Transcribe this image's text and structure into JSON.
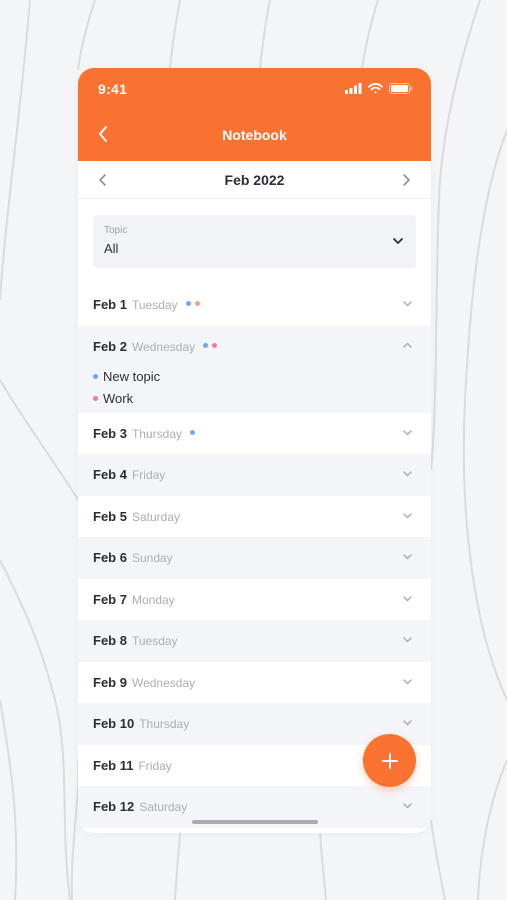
{
  "status": {
    "time": "9:41"
  },
  "nav": {
    "title": "Notebook"
  },
  "month": {
    "label": "Feb 2022"
  },
  "topic_filter": {
    "caption": "Topic",
    "value": "All"
  },
  "days": [
    {
      "date": "Feb 1",
      "weekday": "Tuesday",
      "dots": [
        "#6ea8f0",
        "#f4a27a"
      ],
      "expanded": false
    },
    {
      "date": "Feb 2",
      "weekday": "Wednesday",
      "dots": [
        "#6ea8f0",
        "#f07a9a"
      ],
      "expanded": true,
      "topics": [
        {
          "label": "New topic",
          "color": "#6ea8f0"
        },
        {
          "label": "Work",
          "color": "#f07a9a"
        }
      ]
    },
    {
      "date": "Feb 3",
      "weekday": "Thursday",
      "dots": [
        "#6ea8f0"
      ],
      "expanded": false
    },
    {
      "date": "Feb 4",
      "weekday": "Friday",
      "dots": [],
      "expanded": false
    },
    {
      "date": "Feb 5",
      "weekday": "Saturday",
      "dots": [],
      "expanded": false
    },
    {
      "date": "Feb 6",
      "weekday": "Sunday",
      "dots": [],
      "expanded": false
    },
    {
      "date": "Feb 7",
      "weekday": "Monday",
      "dots": [],
      "expanded": false
    },
    {
      "date": "Feb 8",
      "weekday": "Tuesday",
      "dots": [],
      "expanded": false
    },
    {
      "date": "Feb 9",
      "weekday": "Wednesday",
      "dots": [],
      "expanded": false
    },
    {
      "date": "Feb 10",
      "weekday": "Thursday",
      "dots": [],
      "expanded": false
    },
    {
      "date": "Feb 11",
      "weekday": "Friday",
      "dots": [],
      "expanded": false
    },
    {
      "date": "Feb 12",
      "weekday": "Saturday",
      "dots": [],
      "expanded": false
    }
  ],
  "colors": {
    "accent": "#f97231",
    "text": "#2a2e38",
    "muted": "#a9aeb8",
    "row_alt": "#f4f5f8"
  },
  "icons": {
    "back": "chevron-left-icon",
    "prev": "chevron-left-icon",
    "next": "chevron-right-icon",
    "dropdown": "chevron-down-icon",
    "collapse": "chevron-up-icon",
    "add": "plus-icon"
  }
}
